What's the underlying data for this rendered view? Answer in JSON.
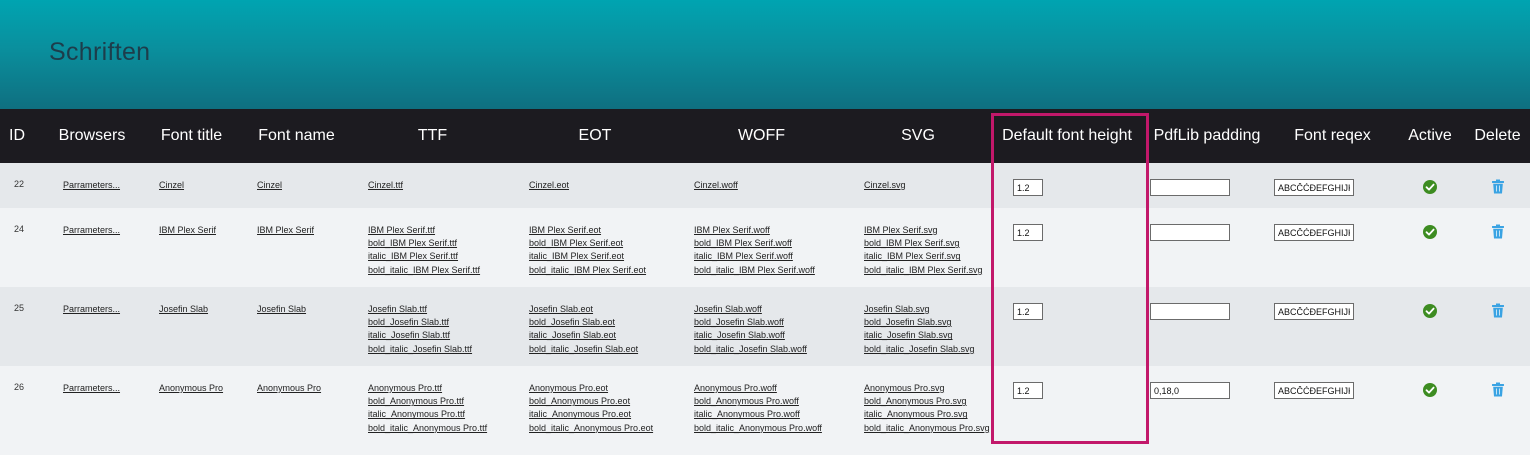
{
  "page": {
    "title": "Schriften"
  },
  "table": {
    "headers": {
      "id": "ID",
      "browsers": "Browsers",
      "font_title": "Font title",
      "font_name": "Font name",
      "ttf": "TTF",
      "eot": "EOT",
      "woff": "WOFF",
      "svg": "SVG",
      "default_font_height": "Default font height",
      "pdflib_padding": "PdfLib padding",
      "font_regex": "Font reqex",
      "active": "Active",
      "delete": "Delete"
    },
    "rows": [
      {
        "id": "22",
        "browsers": "Parrameters...",
        "font_title": "Cinzel",
        "font_name": "Cinzel",
        "ttf": [
          "Cinzel.ttf"
        ],
        "eot": [
          "Cinzel.eot"
        ],
        "woff": [
          "Cinzel.woff"
        ],
        "svg": [
          "Cinzel.svg"
        ],
        "default_font_height": "1.2",
        "pdflib_padding": "",
        "font_regex": "ABCČĆĐEFGHIJKLMNOPQRSŠTUVWXYZŽ",
        "active": true
      },
      {
        "id": "24",
        "browsers": "Parrameters...",
        "font_title": "IBM Plex Serif",
        "font_name": "IBM Plex Serif",
        "ttf": [
          "IBM Plex Serif.ttf",
          "bold_IBM Plex Serif.ttf",
          "italic_IBM Plex Serif.ttf",
          "bold_italic_IBM Plex Serif.ttf"
        ],
        "eot": [
          "IBM Plex Serif.eot",
          "bold_IBM Plex Serif.eot",
          "italic_IBM Plex Serif.eot",
          "bold_italic_IBM Plex Serif.eot"
        ],
        "woff": [
          "IBM Plex Serif.woff",
          "bold_IBM Plex Serif.woff",
          "italic_IBM Plex Serif.woff",
          "bold_italic_IBM Plex Serif.woff"
        ],
        "svg": [
          "IBM Plex Serif.svg",
          "bold_IBM Plex Serif.svg",
          "italic_IBM Plex Serif.svg",
          "bold_italic_IBM Plex Serif.svg"
        ],
        "default_font_height": "1.2",
        "pdflib_padding": "",
        "font_regex": "ABCČĆĐEFGHIJKLMNOPQRSŠTUVWXYZŽ",
        "active": true
      },
      {
        "id": "25",
        "browsers": "Parrameters...",
        "font_title": "Josefin Slab",
        "font_name": "Josefin Slab",
        "ttf": [
          "Josefin Slab.ttf",
          "bold_Josefin Slab.ttf",
          "italic_Josefin Slab.ttf",
          "bold_italic_Josefin Slab.ttf"
        ],
        "eot": [
          "Josefin Slab.eot",
          "bold_Josefin Slab.eot",
          "italic_Josefin Slab.eot",
          "bold_italic_Josefin Slab.eot"
        ],
        "woff": [
          "Josefin Slab.woff",
          "bold_Josefin Slab.woff",
          "italic_Josefin Slab.woff",
          "bold_italic_Josefin Slab.woff"
        ],
        "svg": [
          "Josefin Slab.svg",
          "bold_Josefin Slab.svg",
          "italic_Josefin Slab.svg",
          "bold_italic_Josefin Slab.svg"
        ],
        "default_font_height": "1.2",
        "pdflib_padding": "",
        "font_regex": "ABCČĆĐEFGHIJKLMNOPQRSŠTUVWXYZŽ",
        "active": true
      },
      {
        "id": "26",
        "browsers": "Parrameters...",
        "font_title": "Anonymous Pro",
        "font_name": "Anonymous Pro",
        "ttf": [
          "Anonymous Pro.ttf",
          "bold_Anonymous Pro.ttf",
          "italic_Anonymous Pro.ttf",
          "bold_italic_Anonymous Pro.ttf"
        ],
        "eot": [
          "Anonymous Pro.eot",
          "bold_Anonymous Pro.eot",
          "italic_Anonymous Pro.eot",
          "bold_italic_Anonymous Pro.eot"
        ],
        "woff": [
          "Anonymous Pro.woff",
          "bold_Anonymous Pro.woff",
          "italic_Anonymous Pro.woff",
          "bold_italic_Anonymous Pro.woff"
        ],
        "svg": [
          "Anonymous Pro.svg",
          "bold_Anonymous Pro.svg",
          "italic_Anonymous Pro.svg",
          "bold_italic_Anonymous Pro.svg"
        ],
        "default_font_height": "1.2",
        "pdflib_padding": "0,18,0",
        "font_regex": "ABCČĆĐEFGHIJKLMNOPQRSŠTUVWXYZŽ",
        "active": true
      }
    ]
  },
  "colors": {
    "header_gradient_top": "#00a4b1",
    "header_gradient_bottom": "#0f6f80",
    "table_header_bg": "#1c1b20",
    "row_odd": "#e5e8eb",
    "row_even": "#f1f3f5",
    "active_check": "#3d8c21",
    "trash": "#3aa3e3",
    "highlight_border": "#c2186a"
  },
  "icons": {
    "active": "check-circle-icon",
    "delete": "trash-icon"
  }
}
